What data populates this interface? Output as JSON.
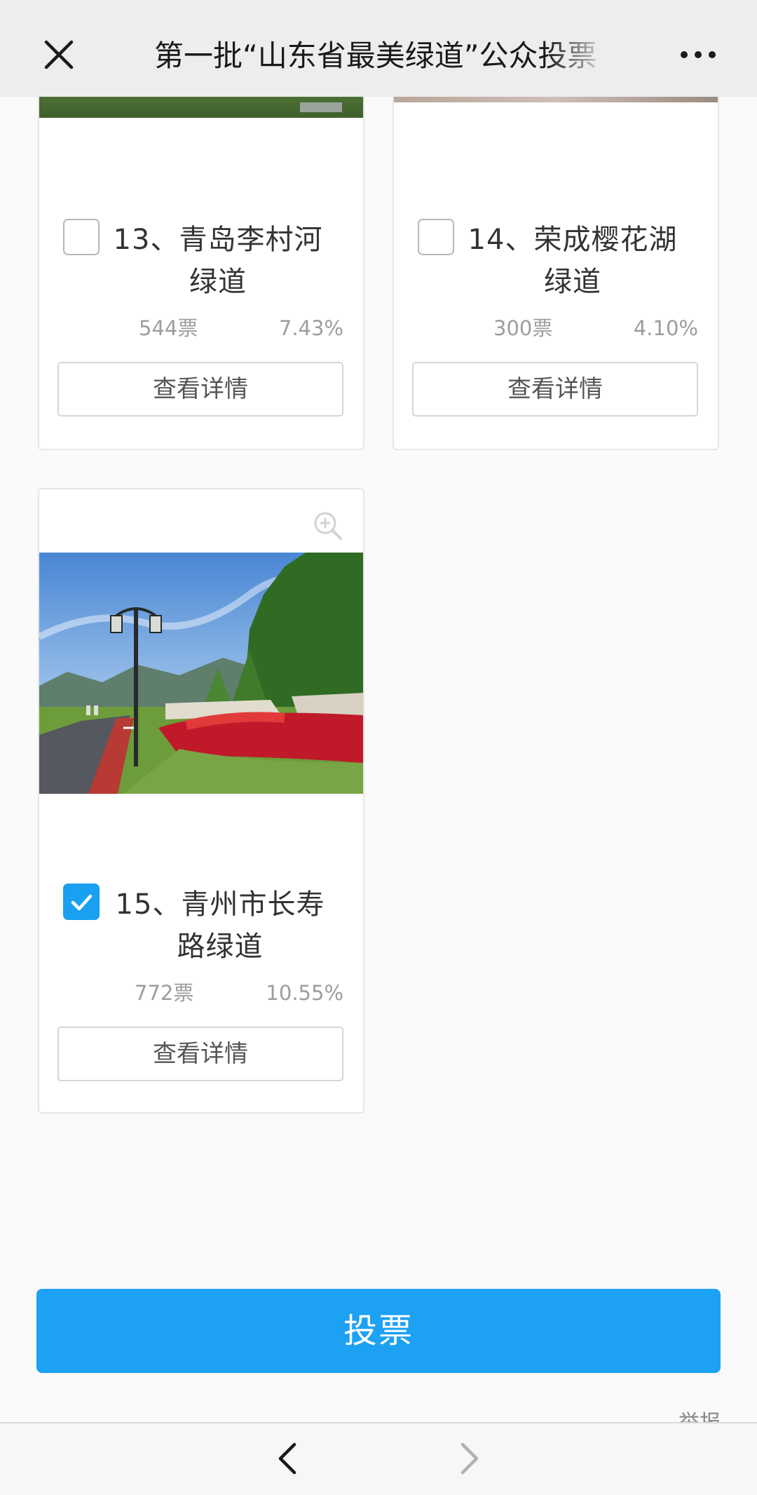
{
  "titlebar": {
    "title": "第一批“山东省最美绿道”公众投票",
    "close_icon": "close-icon",
    "more_icon": "more-icon"
  },
  "items": [
    {
      "name": "13、青岛李村河绿道",
      "votes": "544票",
      "percent": "7.43%",
      "percent_value": 7.43,
      "checked": false,
      "detail_label": "查看详情"
    },
    {
      "name": "14、荣成樱花湖绿道",
      "votes": "300票",
      "percent": "4.10%",
      "percent_value": 4.1,
      "checked": false,
      "detail_label": "查看详情"
    },
    {
      "name": "15、青州市长寿路绿道",
      "votes": "772票",
      "percent": "10.55%",
      "percent_value": 10.55,
      "checked": true,
      "detail_label": "查看详情"
    }
  ],
  "vote_button": "投票",
  "help_text": "举报",
  "navigation": {
    "back_icon": "chevron-left-icon",
    "forward_icon": "chevron-right-icon"
  },
  "colors": {
    "accent": "#1da1f2",
    "checkbox_checked": "#1aa0f0",
    "meta_text": "#9d9d9d"
  }
}
